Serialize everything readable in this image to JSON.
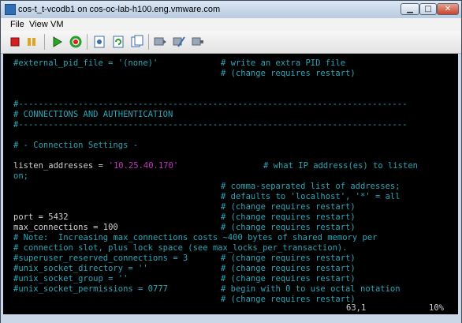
{
  "window": {
    "title": "cos-t_t-vcodb1 on cos-oc-lab-h100.eng.vmware.com"
  },
  "menu": [
    "File",
    "View",
    "VM"
  ],
  "toolbar": {
    "buttons": [
      "stop-icon",
      "pause-icon",
      "play-icon",
      "reset-icon",
      "snapshot-icon",
      "revert-snapshot-icon",
      "manage-snapshots-icon",
      "vm-settings-icon",
      "edit-settings-icon",
      "connect-device-icon"
    ]
  },
  "console": {
    "lines": [
      {
        "text": "#external_pid_file = '(none)'",
        "comment": "# write an extra PID file"
      },
      {
        "text": "",
        "comment": "# (change requires restart)"
      },
      {
        "text": "",
        "comment": ""
      },
      {
        "text": "",
        "comment": ""
      },
      {
        "text": "#------------------------------------------------------------------------------",
        "comment": ""
      },
      {
        "text": "# CONNECTIONS AND AUTHENTICATION",
        "comment": ""
      },
      {
        "text": "#------------------------------------------------------------------------------",
        "comment": ""
      },
      {
        "text": "",
        "comment": ""
      },
      {
        "text": "# - Connection Settings -",
        "comment": ""
      },
      {
        "text": "",
        "comment": ""
      },
      {
        "key": "listen_addresses = ",
        "value": "'10.25.40.170'",
        "comment": "# what IP address(es) to listen"
      },
      {
        "text": "on;",
        "comment": ""
      },
      {
        "text": "",
        "comment": "# comma-separated list of addresses;"
      },
      {
        "text": "",
        "comment": "# defaults to 'localhost', '*' = all"
      },
      {
        "text": "",
        "comment": "# (change requires restart)"
      },
      {
        "key": "port = 5432",
        "comment": "# (change requires restart)"
      },
      {
        "key": "max_connections = 100",
        "comment": "# (change requires restart)"
      },
      {
        "text": "# Note:  Increasing max_connections costs ~400 bytes of shared memory per",
        "comment": ""
      },
      {
        "text": "# connection slot, plus lock space (see max_locks_per_transaction).",
        "comment": ""
      },
      {
        "text": "#superuser_reserved_connections = 3",
        "comment": "# (change requires restart)"
      },
      {
        "text": "#unix_socket_directory = ''",
        "comment": "# (change requires restart)"
      },
      {
        "text": "#unix_socket_group = ''",
        "comment": "# (change requires restart)"
      },
      {
        "text": "#unix_socket_permissions = 0777",
        "comment": "# begin with 0 to use octal notation"
      },
      {
        "text": "",
        "comment": "# (change requires restart)"
      }
    ],
    "status_position": "63,1",
    "status_percent": "10%"
  }
}
